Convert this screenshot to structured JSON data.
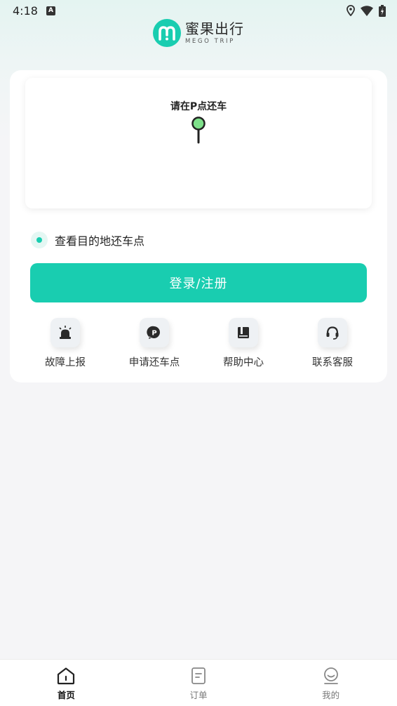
{
  "status_bar": {
    "time": "4:18",
    "notification_icon": "A"
  },
  "logo": {
    "cn": "蜜果出行",
    "en": "MEGO TRIP"
  },
  "map": {
    "title": "请在P点还车"
  },
  "destination_toggle": {
    "label": "查看目的地还车点"
  },
  "login_button": {
    "label": "登录/注册"
  },
  "quick_actions": [
    {
      "label": "故障上报",
      "icon": "alarm-icon"
    },
    {
      "label": "申请还车点",
      "icon": "parking-icon"
    },
    {
      "label": "帮助中心",
      "icon": "book-icon"
    },
    {
      "label": "联系客服",
      "icon": "headset-icon"
    }
  ],
  "bottom_nav": [
    {
      "label": "首页",
      "icon": "home-icon",
      "active": true
    },
    {
      "label": "订单",
      "icon": "order-icon",
      "active": false
    },
    {
      "label": "我的",
      "icon": "profile-icon",
      "active": false
    }
  ],
  "colors": {
    "brand": "#19cdb0",
    "pin": "#7ee08a",
    "text": "#222222"
  }
}
